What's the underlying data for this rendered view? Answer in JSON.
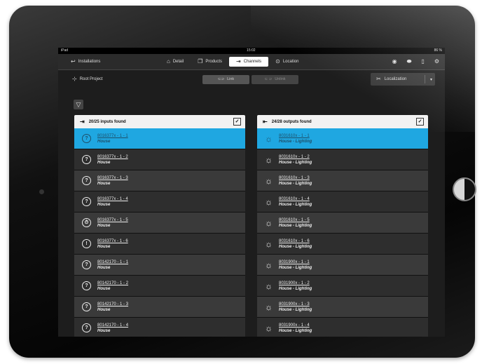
{
  "status": {
    "device": "iPad",
    "time": "15:02",
    "battery": "86 %"
  },
  "toolbar": {
    "installations_label": "Installations",
    "tabs": [
      {
        "label": "Detail"
      },
      {
        "label": "Products"
      },
      {
        "label": "Channels"
      },
      {
        "label": "Location"
      }
    ]
  },
  "project": {
    "root_label": "Root Project"
  },
  "actions": {
    "link_label": "Link",
    "unlink_label": "Unlink",
    "localization_label": "Localization"
  },
  "inputs": {
    "header": "20/25 inputs found",
    "items": [
      {
        "code": "8016377x - 1 - 1",
        "place": "House",
        "icon": "?"
      },
      {
        "code": "8016377x - 1 - 2",
        "place": "House",
        "icon": "?"
      },
      {
        "code": "8016377x - 1 - 3",
        "place": "House",
        "icon": "?"
      },
      {
        "code": "8016377x - 1 - 4",
        "place": "House",
        "icon": "?"
      },
      {
        "code": "8016377x - 1 - 5",
        "place": "House",
        "icon": "timer"
      },
      {
        "code": "8016377x - 1 - 6",
        "place": "House",
        "icon": "!"
      },
      {
        "code": "80142170 - 1 - 1",
        "place": "House",
        "icon": "?"
      },
      {
        "code": "80142170 - 1 - 2",
        "place": "House",
        "icon": "?"
      },
      {
        "code": "80142170 - 1 - 3",
        "place": "House",
        "icon": "?"
      },
      {
        "code": "80142170 - 1 - 4",
        "place": "House",
        "icon": "?"
      }
    ]
  },
  "outputs": {
    "header": "24/28 outputs found",
    "items": [
      {
        "code": "8031610x - 1 - 1",
        "place": "House - Lighting"
      },
      {
        "code": "8031610x - 1 - 2",
        "place": "House - Lighting"
      },
      {
        "code": "8031610x - 1 - 3",
        "place": "House - Lighting"
      },
      {
        "code": "8031610x - 1 - 4",
        "place": "House - Lighting"
      },
      {
        "code": "8031610x - 1 - 5",
        "place": "House - Lighting"
      },
      {
        "code": "8031610x - 1 - 6",
        "place": "House - Lighting"
      },
      {
        "code": "8031900x - 1 - 1",
        "place": "House - Lighting"
      },
      {
        "code": "8031900x - 1 - 2",
        "place": "House - Lighting"
      },
      {
        "code": "8031900x - 1 - 3",
        "place": "House - Lighting"
      },
      {
        "code": "8031900x - 1 - 4",
        "place": "House - Lighting"
      }
    ]
  },
  "colors": {
    "selected": "#1fa7e1",
    "background": "#1d1d1d"
  }
}
